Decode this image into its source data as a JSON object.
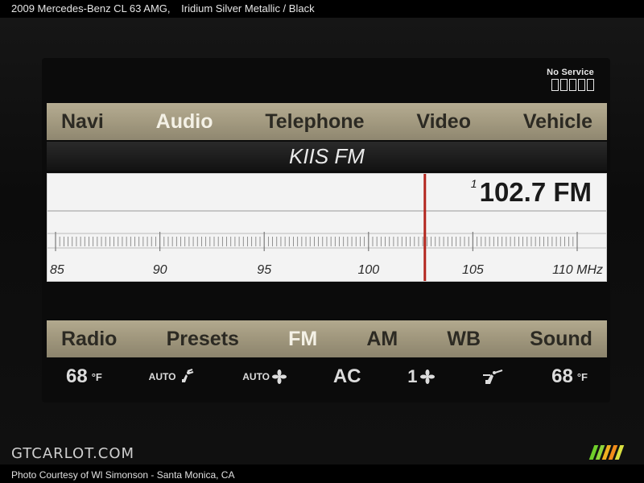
{
  "caption": {
    "vehicle": "2009 Mercedes-Benz CL 63 AMG,",
    "color": "Iridium Silver Metallic / Black"
  },
  "status": {
    "label": "No Service"
  },
  "top_menu": [
    {
      "label": "Navi",
      "active": false
    },
    {
      "label": "Audio",
      "active": true
    },
    {
      "label": "Telephone",
      "active": false
    },
    {
      "label": "Video",
      "active": false
    },
    {
      "label": "Vehicle",
      "active": false
    }
  ],
  "station": {
    "name": "KIIS FM"
  },
  "tuner": {
    "preset_number": "1",
    "frequency_display": "102.7 FM",
    "frequency": 102.7,
    "scale_min": 85,
    "scale_max": 110,
    "scale_labels": [
      "85",
      "90",
      "95",
      "100",
      "105",
      "110 MHz"
    ]
  },
  "bottom_menu": [
    {
      "label": "Radio",
      "active": false
    },
    {
      "label": "Presets",
      "active": false
    },
    {
      "label": "FM",
      "active": true
    },
    {
      "label": "AM",
      "active": false
    },
    {
      "label": "WB",
      "active": false
    },
    {
      "label": "Sound",
      "active": false
    }
  ],
  "climate": {
    "left_temp": "68",
    "temp_unit": "F",
    "auto_airflow_label": "AUTO",
    "auto_fan_label": "AUTO",
    "ac_label": "AC",
    "fan_level": "1",
    "right_temp": "68"
  },
  "footer": {
    "watermark": "GTCARLOT.COM",
    "credit": "Photo Courtesy of Wl Simonson - Santa Monica, CA"
  },
  "colors": {
    "menu_bar": "#a39a80",
    "menu_text": "#2c2a23",
    "menu_active_text": "#f4f1e6",
    "tuner_needle": "#b3261e",
    "logo": [
      "#6fcf2a",
      "#8fd43a",
      "#f0b020",
      "#f28c1a",
      "#d9e040"
    ]
  }
}
